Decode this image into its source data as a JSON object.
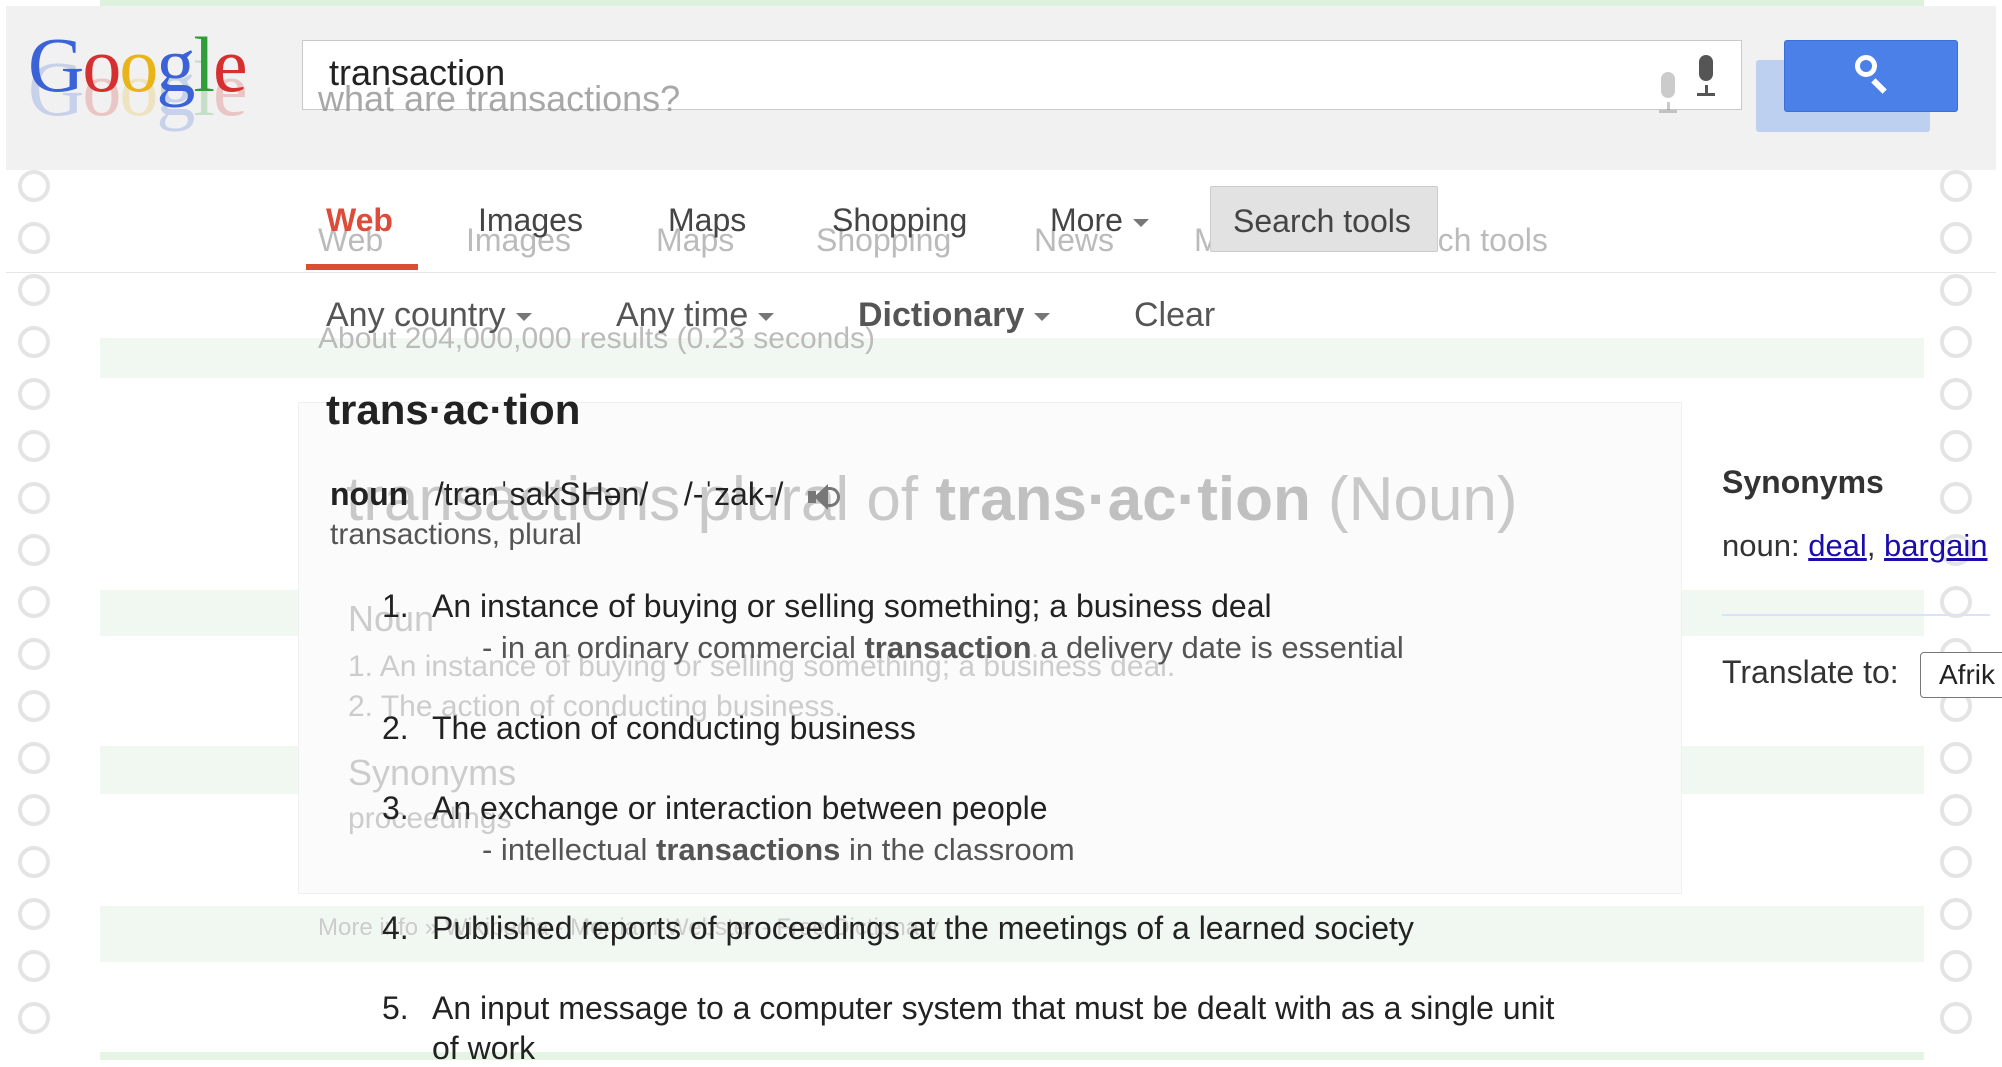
{
  "header": {
    "logo_text": "Google",
    "search_value": "transaction",
    "ghost_query": "what are transactions?"
  },
  "tabs": {
    "items": [
      "Web",
      "Images",
      "Maps",
      "Shopping",
      "More"
    ],
    "search_tools": "Search tools",
    "ghost_items": [
      "Web",
      "Images",
      "Maps",
      "Shopping",
      "News",
      "More",
      "Search tools"
    ]
  },
  "filters": {
    "country": "Any country",
    "time": "Any time",
    "dictionary": "Dictionary",
    "clear": "Clear"
  },
  "results_stats_ghost": "About 204,000,000 results (0.23 seconds)",
  "dictionary": {
    "headword": "trans·ac·tion",
    "pos": "noun",
    "pron1": "/tranˈsakSHən/",
    "pron2": "/-ˈzak-/",
    "inflection": "transactions, plural",
    "definitions": [
      {
        "num": "1.",
        "text": "An instance of buying or selling something; a business deal",
        "example_pre": "- in an ordinary commercial ",
        "example_bold": "transaction",
        "example_post": " a delivery date is essential"
      },
      {
        "num": "2.",
        "text": "The action of conducting business"
      },
      {
        "num": "3.",
        "text": "An exchange or interaction between people",
        "example_pre": "- intellectual ",
        "example_bold": "transactions",
        "example_post": " in the classroom"
      },
      {
        "num": "4.",
        "text": "Published reports of proceedings at the meetings of a learned society"
      },
      {
        "num": "5.",
        "text": "An input message to a computer system that must be dealt with as a single unit",
        "text2": "of work"
      }
    ]
  },
  "ghost_panel": {
    "big_word": "transactions",
    "big_rest_pre": "plural of ",
    "big_bold": "trans·ac·tion",
    "big_rest_post": " (Noun)",
    "noun": "Noun",
    "def1": "1.  An instance of buying or selling something; a business deal.",
    "def2": "2.  The action of conducting business.",
    "synonyms": "Synonyms",
    "syn_value": "proceedings",
    "more_info": "More info »  Wikipedia - Merriam-Webster - Free Dictionary"
  },
  "right_panel": {
    "synonyms_title": "Synonyms",
    "noun_label": "noun: ",
    "syn1": "deal",
    "syn2": "bargain",
    "translate_label": "Translate to:",
    "language": "Afrik"
  },
  "colors": {
    "accent_red": "#dd4b39",
    "button_blue": "#4a80e8",
    "link_blue": "#1a0dab"
  }
}
